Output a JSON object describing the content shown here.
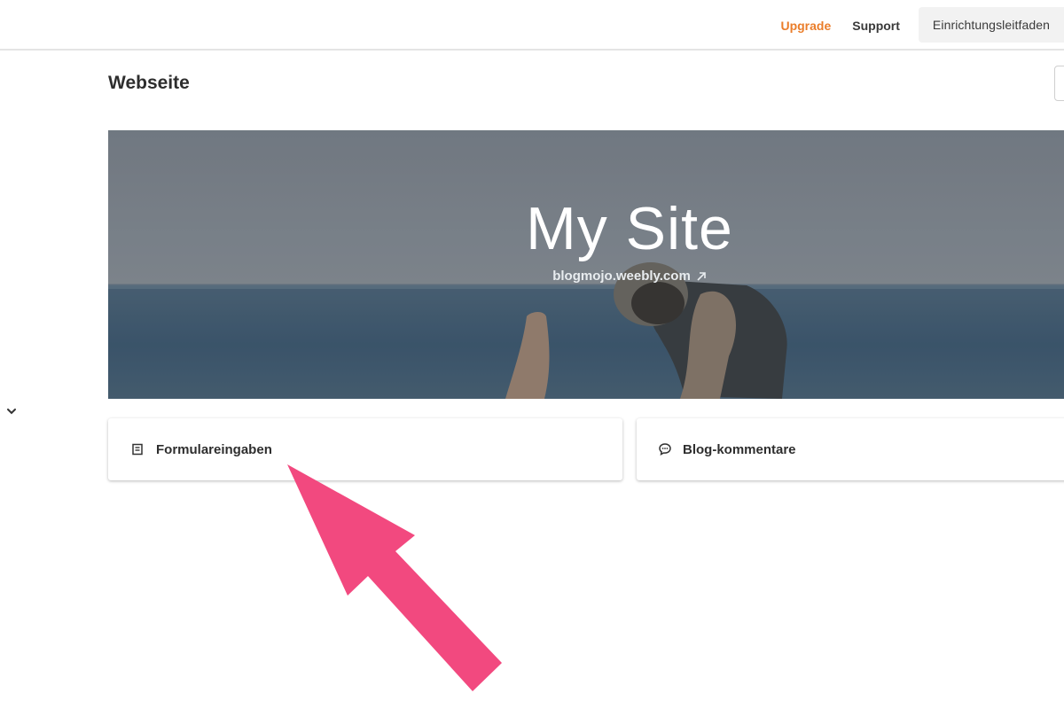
{
  "topbar": {
    "upgrade_label": "Upgrade",
    "support_label": "Support",
    "guide_label": "Einrichtungsleitfaden"
  },
  "page": {
    "title": "Webseite"
  },
  "hero": {
    "site_title": "My Site",
    "site_url": "blogmojo.weebly.com",
    "link_icon": "external-link-icon"
  },
  "cards": {
    "forms_label": "Formulareingaben",
    "forms_icon": "form-icon",
    "blog_label": "Blog-kommentare",
    "blog_icon": "comment-icon"
  },
  "colors": {
    "upgrade": "#ea7d2a",
    "annotation_arrow": "#f2497f"
  }
}
